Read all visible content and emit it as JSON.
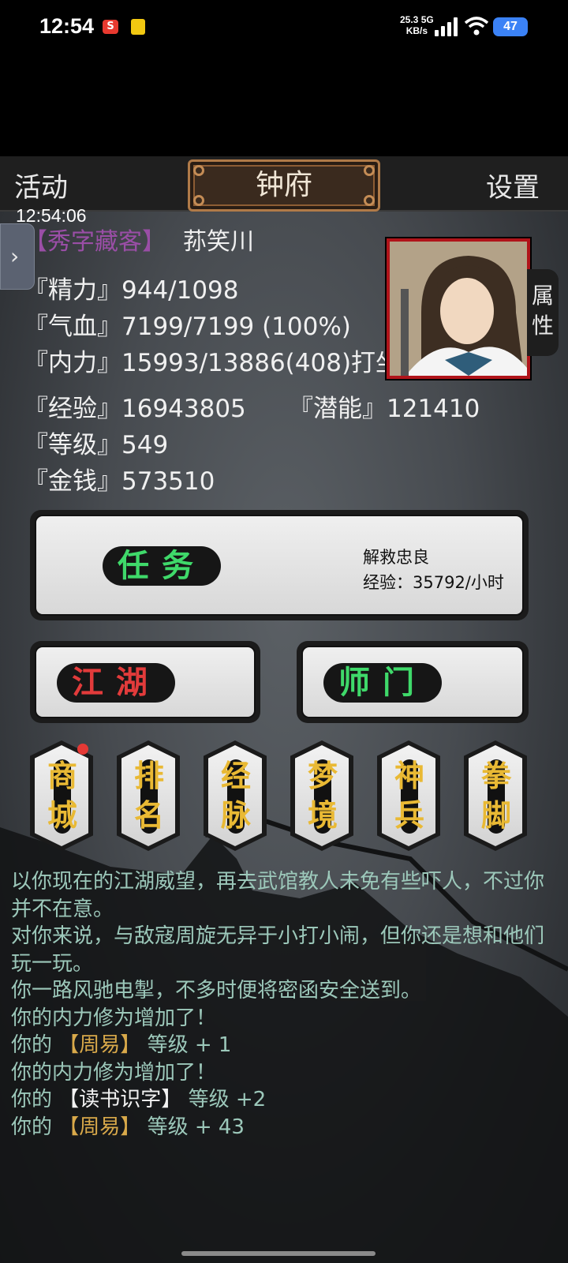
{
  "status_bar": {
    "time": "12:54",
    "net_speed": "25.3",
    "net_unit": "KB/s",
    "net_type": "5G",
    "battery": "47"
  },
  "header": {
    "left": "活动",
    "title": "钟府",
    "right": "设置"
  },
  "clock": "12:54:06",
  "character": {
    "title": "【秀字藏客】",
    "name": "荪笑川",
    "attr_tab": "属性",
    "stats": {
      "jingli": "『精力』944/1098",
      "qixue": "『气血』7199/7199 (100%)",
      "neili": "『内力』15993/13886(408)打坐",
      "jingyan": "『经验』16943805",
      "qianneng": "『潜能』121410",
      "dengji": "『等级』549",
      "jinqian": "『金钱』573510"
    }
  },
  "task_panel": {
    "button": "任务",
    "info_line1": "解救忠良",
    "info_line2": "经验：35792/小时",
    "accent": "#3fd96a"
  },
  "jianghu_button": {
    "label": "江湖",
    "accent": "#e23b3b"
  },
  "shimen_button": {
    "label": "师门",
    "accent": "#3fd96a"
  },
  "menu": [
    {
      "label": "商城",
      "badge": true
    },
    {
      "label": "排名"
    },
    {
      "label": "经脉"
    },
    {
      "label": "梦境"
    },
    {
      "label": "神兵"
    },
    {
      "label": "拳脚"
    }
  ],
  "log": {
    "l1": "以你现在的江湖威望，再去武馆教人未免有些吓人，不过你并不在意。",
    "l2": "对你来说，与敌寇周旋无异于小打小闹，但你还是想和他们玩一玩。",
    "l3": "你一路风驰电掣，不多时便将密函安全送到。",
    "l4": "你的内力修为增加了！",
    "l5_a": "你的",
    "l5_b": "【周易】",
    "l5_c": "等级 + 1",
    "l6": "你的内力修为增加了！",
    "l7_a": "你的",
    "l7_b": "【读书识字】",
    "l7_c": "等级 +2",
    "l8_a": "你的",
    "l8_b": "【周易】",
    "l8_c": "等级 + 43"
  }
}
